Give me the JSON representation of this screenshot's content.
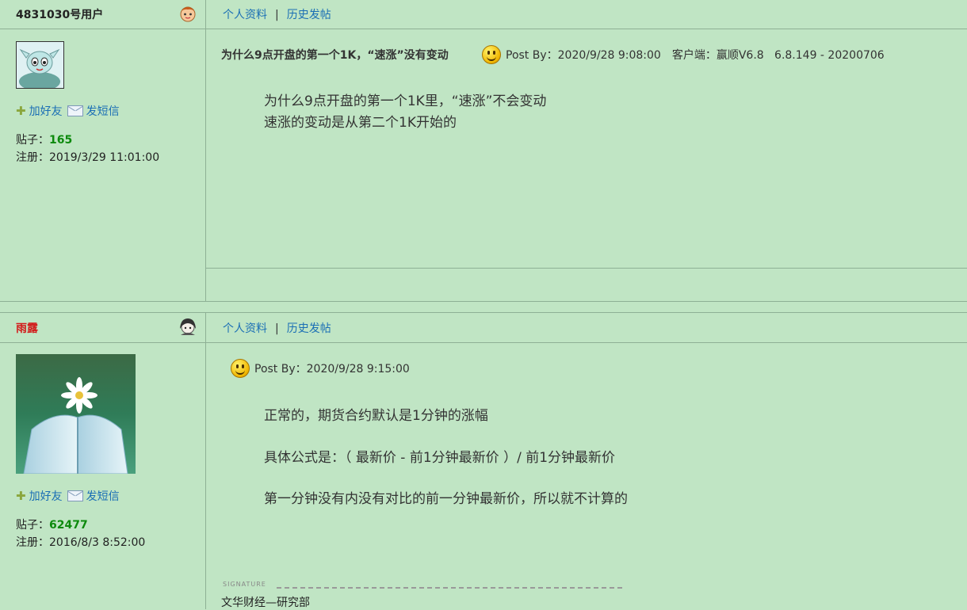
{
  "posts": [
    {
      "username": "4831030号用户",
      "nav": {
        "profile": "个人资料",
        "separator": "|",
        "history": "历史发帖"
      },
      "actions": {
        "add_friend": "加好友",
        "send_message": "发短信"
      },
      "stats": {
        "posts_label": "贴子：",
        "posts_value": "165",
        "register_label": "注册：",
        "register_value": "2019/3/29 11:01:00"
      },
      "title": "为什么9点开盘的第一个1K，“速涨”没有变动",
      "meta": {
        "post_by": "Post By：2020/9/28 9:08:00",
        "client_label": "客户端：赢顺V6.8",
        "client_version": "6.8.149 - 20200706"
      },
      "body": [
        " 为什么9点开盘的第一个1K里，“速涨”不会变动",
        "速涨的变动是从第二个1K开始的"
      ]
    },
    {
      "username": "雨露",
      "nav": {
        "profile": "个人资料",
        "separator": "|",
        "history": "历史发帖"
      },
      "actions": {
        "add_friend": "加好友",
        "send_message": "发短信"
      },
      "stats": {
        "posts_label": "贴子：",
        "posts_value": "62477",
        "register_label": "注册：",
        "register_value": "2016/8/3 8:52:00"
      },
      "meta": {
        "post_by": "Post By：2020/9/28 9:15:00"
      },
      "body": [
        "正常的，期货合约默认是1分钟的涨幅",
        "具体公式是：（ 最新价 - 前1分钟最新价 ）/ 前1分钟最新价",
        "第一分钟没有内没有对比的前一分钟最新价，所以就不计算的"
      ],
      "signature_label": "SIGNATURE",
      "signature": "文华财经—研究部"
    }
  ],
  "colors": {
    "background": "#c0e5c4",
    "link": "#1b6fb5",
    "border": "#8eb095",
    "count": "#0d8a0d",
    "name_red": "#d21a1a"
  }
}
